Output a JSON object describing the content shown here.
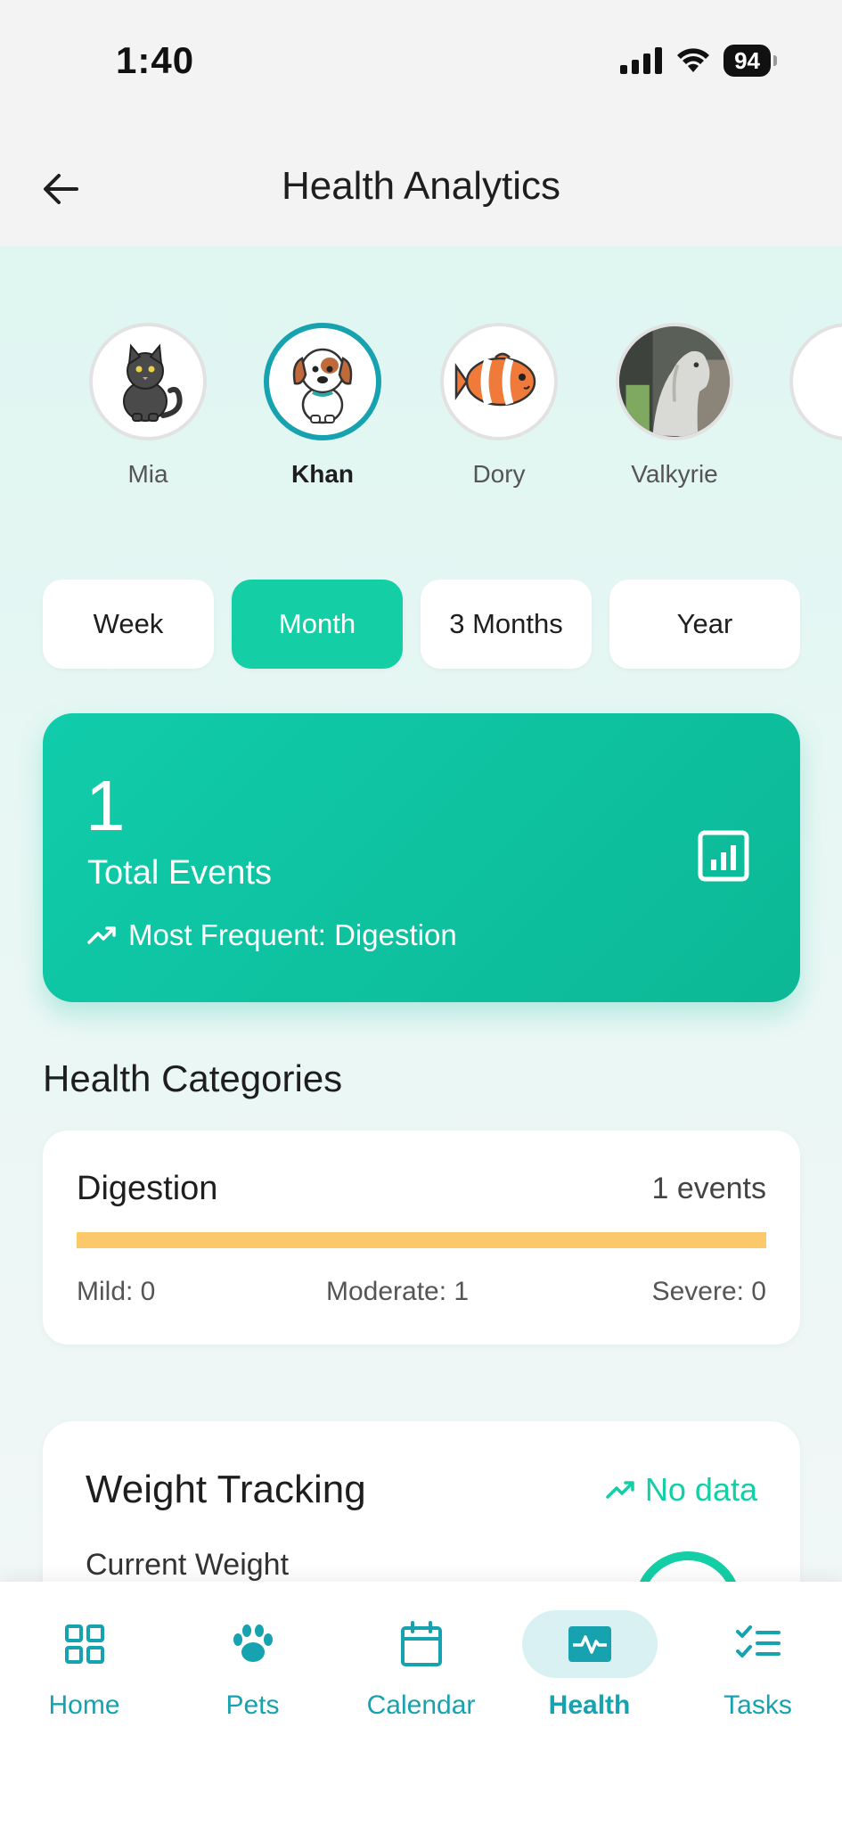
{
  "status_bar": {
    "time": "1:40",
    "battery": "94"
  },
  "header": {
    "title": "Health Analytics"
  },
  "pets": [
    {
      "name": "Mia",
      "icon": "cat-icon",
      "selected": false
    },
    {
      "name": "Khan",
      "icon": "dog-icon",
      "selected": true
    },
    {
      "name": "Dory",
      "icon": "fish-icon",
      "selected": false
    },
    {
      "name": "Valkyrie",
      "icon": "horse-photo",
      "selected": false
    }
  ],
  "periods": [
    {
      "label": "Week",
      "active": false
    },
    {
      "label": "Month",
      "active": true
    },
    {
      "label": "3 Months",
      "active": false
    },
    {
      "label": "Year",
      "active": false
    }
  ],
  "summary": {
    "value": "1",
    "label": "Total Events",
    "most_frequent": "Most Frequent: Digestion",
    "icon": "bar-chart-icon"
  },
  "categories_section": {
    "title": "Health Categories",
    "items": [
      {
        "name": "Digestion",
        "count": "1 events",
        "mild": "Mild: 0",
        "moderate": "Moderate: 1",
        "severe": "Severe: 0",
        "bar_color": "#fbc86a"
      }
    ]
  },
  "weight": {
    "title": "Weight Tracking",
    "status": "No data",
    "current_label": "Current Weight"
  },
  "tabbar": [
    {
      "label": "Home",
      "icon": "grid-icon",
      "active": false
    },
    {
      "label": "Pets",
      "icon": "paw-icon",
      "active": false
    },
    {
      "label": "Calendar",
      "icon": "calendar-icon",
      "active": false
    },
    {
      "label": "Health",
      "icon": "pulse-icon",
      "active": true
    },
    {
      "label": "Tasks",
      "icon": "checklist-icon",
      "active": false
    }
  ],
  "colors": {
    "accent": "#14cfa6",
    "teal": "#17a2b0",
    "bar": "#fbc86a"
  }
}
